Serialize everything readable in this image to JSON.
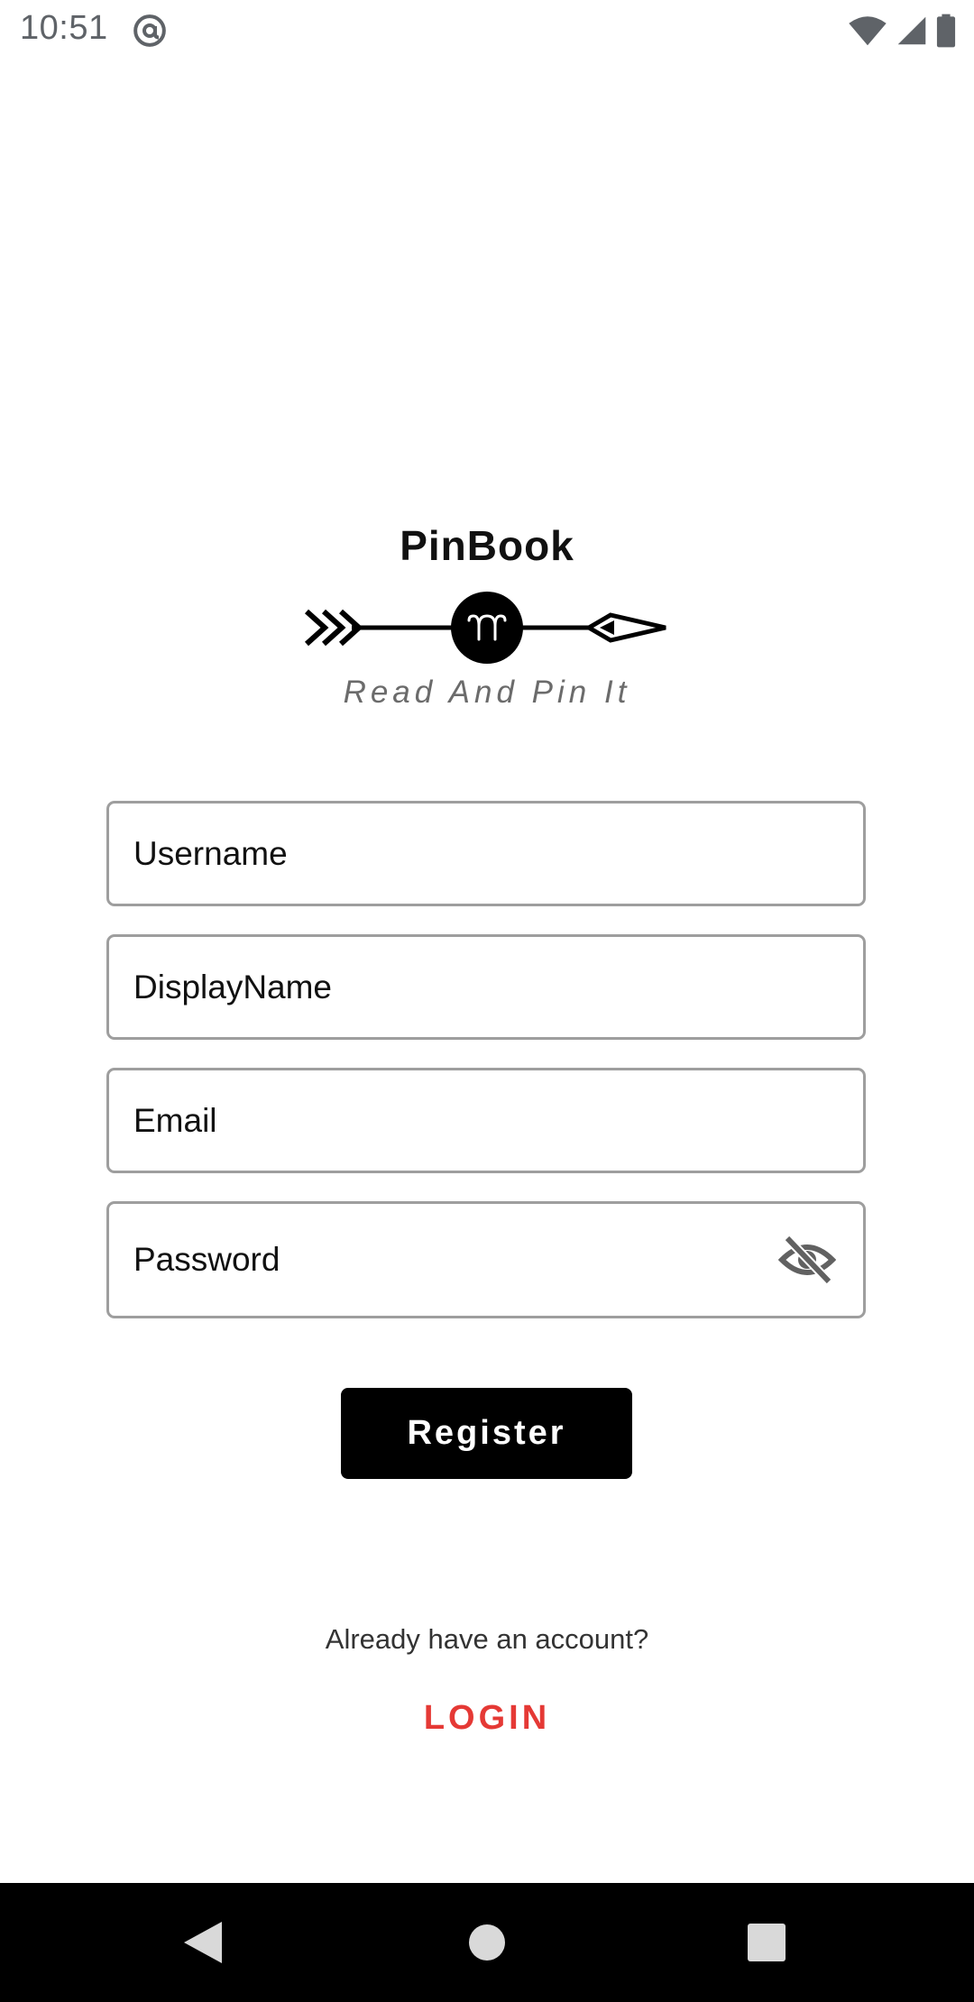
{
  "status_bar": {
    "time": "10:51",
    "icons": [
      "at-sign-icon",
      "wifi-icon",
      "cellular-signal-icon",
      "battery-icon"
    ]
  },
  "logo": {
    "title": "PinBook",
    "tagline": "Read And Pin It",
    "emblem_icon": "aries-arrow-icon"
  },
  "form": {
    "username_label": "Username",
    "displayname_label": "DisplayName",
    "email_label": "Email",
    "password_label": "Password",
    "password_toggle_icon": "eye-off-icon",
    "register_label": "Register"
  },
  "footer": {
    "prompt": "Already have an account?",
    "login_label": "LOGIN"
  },
  "nav_bar": {
    "icons": [
      "back-icon",
      "home-icon",
      "recents-icon"
    ]
  },
  "colors": {
    "accent": "#e53935",
    "button_bg": "#000000",
    "field_border": "#9e9e9e",
    "nav_bg": "#000000"
  }
}
